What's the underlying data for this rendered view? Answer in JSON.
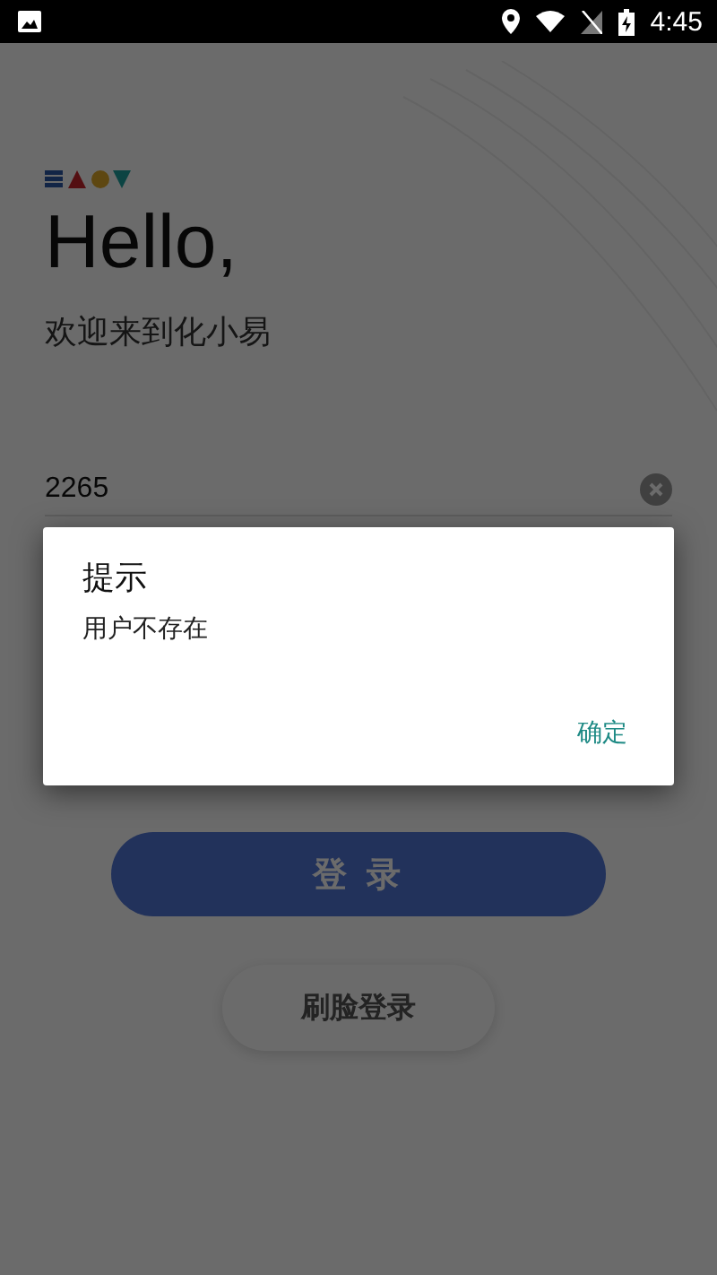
{
  "status_bar": {
    "time": "4:45"
  },
  "login": {
    "greeting": "Hello,",
    "subtitle": "欢迎来到化小易",
    "phone": {
      "value": "2265"
    },
    "login_button": "登 录",
    "face_login_button": "刷脸登录"
  },
  "dialog": {
    "title": "提示",
    "message": "用户不存在",
    "confirm": "确定"
  }
}
